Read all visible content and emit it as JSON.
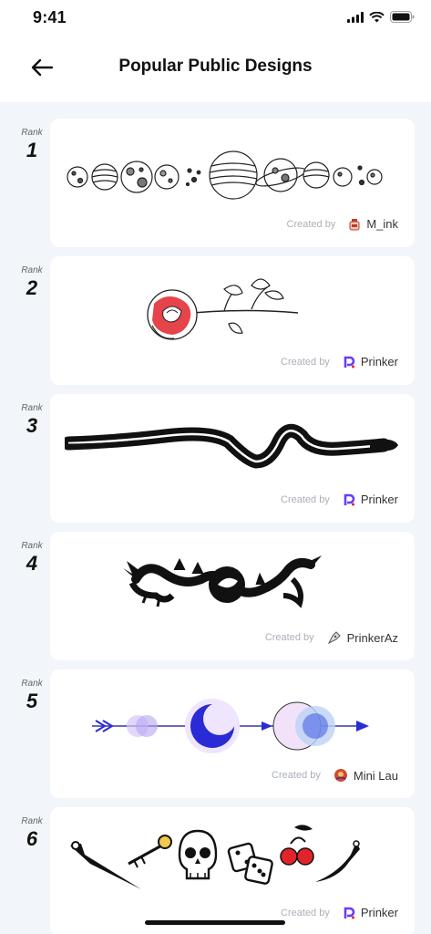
{
  "status": {
    "time": "9:41"
  },
  "header": {
    "title": "Popular Public Designs"
  },
  "list": {
    "rank_label": "Rank",
    "created_by_label": "Created by",
    "items": [
      {
        "rank": "1",
        "creator": "M_ink",
        "creator_icon": "ink-bottle-icon",
        "design": "planets-row-design"
      },
      {
        "rank": "2",
        "creator": "Prinker",
        "creator_icon": "prinker-logo-icon",
        "design": "rose-design"
      },
      {
        "rank": "3",
        "creator": "Prinker",
        "creator_icon": "prinker-logo-icon",
        "design": "snake-design"
      },
      {
        "rank": "4",
        "creator": "PrinkerAz",
        "creator_icon": "pen-nib-icon",
        "design": "dragon-design"
      },
      {
        "rank": "5",
        "creator": "Mini Lau",
        "creator_icon": "mini-lau-avatar-icon",
        "design": "moon-arrow-design"
      },
      {
        "rank": "6",
        "creator": "Prinker",
        "creator_icon": "prinker-logo-icon",
        "design": "skull-dice-dagger-design"
      }
    ]
  },
  "colors": {
    "background": "#f2f5f9",
    "card": "#ffffff",
    "prinker_purple": "#6b3cf5",
    "rose_red": "#e0242a",
    "moon_blue": "#2a2ad6"
  }
}
